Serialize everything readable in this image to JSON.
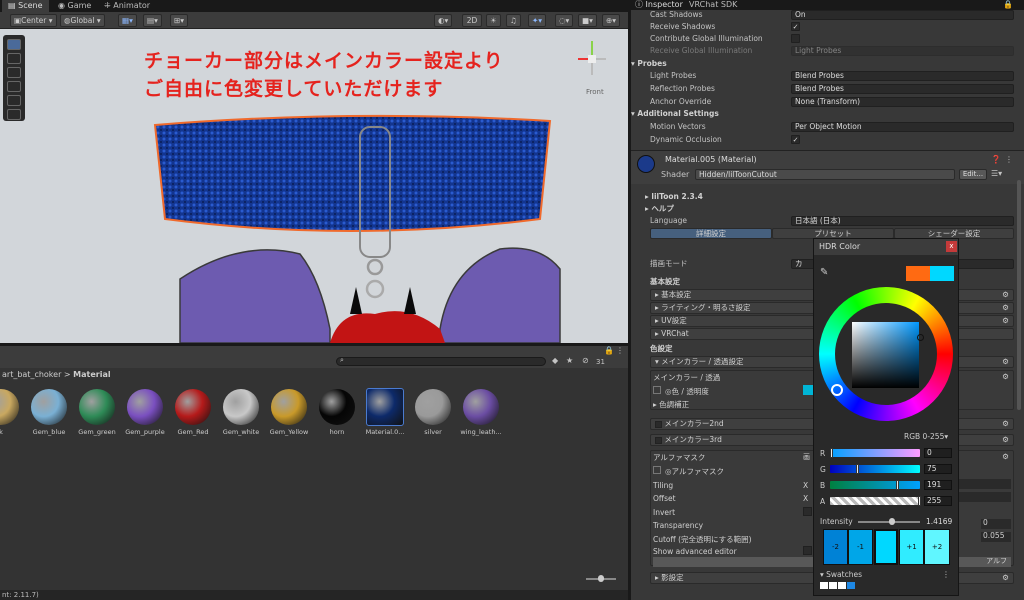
{
  "scene_tabs": {
    "scene": "Scene",
    "game": "Game",
    "animator": "Animator"
  },
  "toolbar": {
    "pivot": "Center",
    "space": "Global",
    "mode2d": "2D"
  },
  "viewport": {
    "line1": "チョーカー部分はメインカラー設定より",
    "line2": "ご自由に色変更していただけます",
    "gizmo_label": "Front"
  },
  "project": {
    "breadcrumb_parent": "art_bat_choker",
    "breadcrumb_sep": ">",
    "breadcrumb_current": "Material",
    "count": "31",
    "assets": [
      {
        "label": "k",
        "color": "#c9a860"
      },
      {
        "label": "Gem_blue",
        "color": "#7ab0d4"
      },
      {
        "label": "Gem_green",
        "color": "#2e8b57"
      },
      {
        "label": "Gem_purple",
        "color": "#7a4fc0"
      },
      {
        "label": "Gem_Red",
        "color": "#b51a1a"
      },
      {
        "label": "Gem_white",
        "color": "#c8c8c8"
      },
      {
        "label": "Gem_Yellow",
        "color": "#c99a2a"
      },
      {
        "label": "horn",
        "color": "#050505"
      },
      {
        "label": "Material.0...",
        "color": "#0d2a6a"
      },
      {
        "label": "silver",
        "color": "#9a9a9a"
      },
      {
        "label": "wing_leath...",
        "color": "#6b4da3"
      }
    ]
  },
  "status": "nt: 2.11.7)",
  "inspector": {
    "tabs": {
      "inspector": "Inspector",
      "vrchat": "VRChat SDK"
    },
    "rows": [
      {
        "label": "Cast Shadows",
        "value": "On",
        "kind": "field"
      },
      {
        "label": "Receive Shadows",
        "value": "✓",
        "kind": "check"
      },
      {
        "label": "Contribute Global Illumination",
        "value": "",
        "kind": "check"
      },
      {
        "label": "Receive Global Illumination",
        "value": "Light Probes",
        "kind": "dim"
      }
    ],
    "probes": {
      "title": "Probes",
      "rows": [
        {
          "label": "Light Probes",
          "value": "Blend Probes"
        },
        {
          "label": "Reflection Probes",
          "value": "Blend Probes"
        },
        {
          "label": "Anchor Override",
          "value": "None (Transform)"
        }
      ]
    },
    "additional": {
      "title": "Additional Settings",
      "rows": [
        {
          "label": "Motion Vectors",
          "value": "Per Object Motion"
        },
        {
          "label": "Dynamic Occlusion",
          "value": "✓"
        }
      ]
    },
    "material": {
      "name": "Material.005 (Material)",
      "shader_label": "Shader",
      "shader": "Hidden/lilToonCutout",
      "edit": "Edit..."
    },
    "liltoon": {
      "version": "lilToon 2.3.4",
      "help": "ヘルプ",
      "language_label": "Language",
      "language": "日本語 (日本)",
      "tabs": [
        "詳細設定",
        "プリセット",
        "シェーダー設定"
      ],
      "render_mode_label": "描画モード",
      "render_mode": "カ",
      "basic_title": "基本設定",
      "basic_items": [
        "基本設定",
        "ライティング・明るさ設定",
        "UV設定",
        "VRChat"
      ],
      "color_title": "色設定",
      "main_group": "メインカラー / 透過設定",
      "main_sub": "メインカラー / 透過",
      "color_alpha": "◎色 / 透明度",
      "tone": "色調補正",
      "main2": "メインカラー2nd",
      "main3": "メインカラー3rd",
      "alpha_mask": "アルファマスク",
      "alpha_mask_field": "◎アルファマスク",
      "tiling": "Tiling",
      "offset": "Offset",
      "invert": "Invert",
      "transparency": "Transparency",
      "transparency_val": "0",
      "cutoff": "Cutoff (完全透明にする範囲)",
      "cutoff_val": "0.055",
      "advanced": "Show advanced editor",
      "alpha_btn": "アルフ",
      "shadow": "影設定",
      "x": "X"
    }
  },
  "hdr": {
    "title": "HDR Color",
    "close": "x",
    "mode": "RGB 0-255▾",
    "colors": {
      "previous": "#ff6a12",
      "current": "#00d8ff"
    },
    "channels": [
      {
        "name": "R",
        "value": "0",
        "frac": 0.0
      },
      {
        "name": "G",
        "value": "75",
        "frac": 0.294
      },
      {
        "name": "B",
        "value": "191",
        "frac": 0.749
      },
      {
        "name": "A",
        "value": "255",
        "frac": 1.0
      }
    ],
    "intensity_label": "Intensity",
    "intensity_value": "1.4169",
    "swatch_labels": [
      "-2",
      "-1",
      "",
      "+1",
      "+2"
    ],
    "swatches_label": "Swatches"
  }
}
